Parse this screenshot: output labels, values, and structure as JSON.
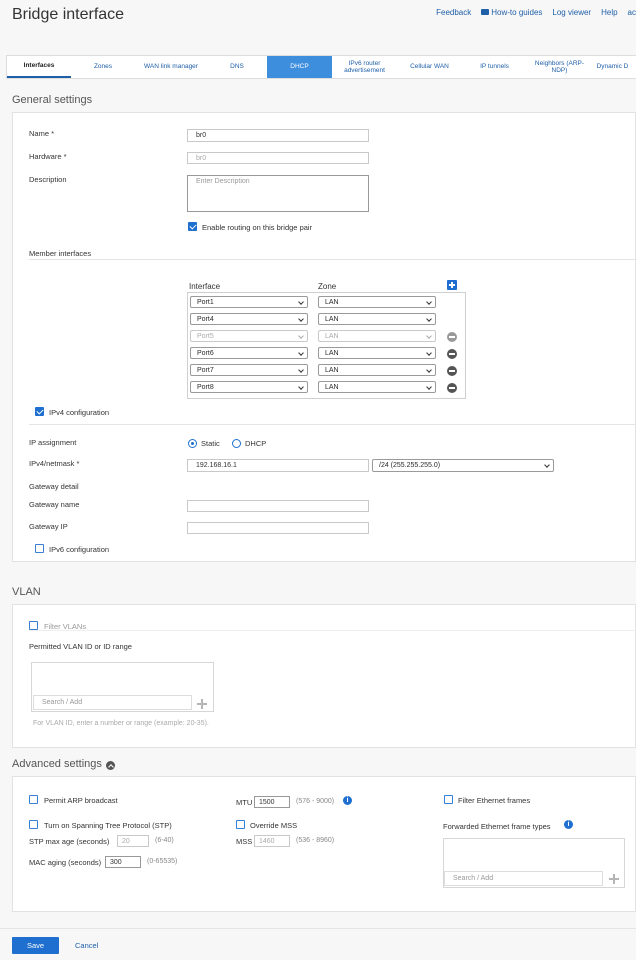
{
  "page": {
    "title": "Bridge interface"
  },
  "toplinks": {
    "feedback": "Feedback",
    "howto": "How-to guides",
    "logviewer": "Log viewer",
    "help": "Help",
    "user": "ac"
  },
  "tabs": [
    {
      "label": "Interfaces"
    },
    {
      "label": "Zones"
    },
    {
      "label": "WAN link manager"
    },
    {
      "label": "DNS"
    },
    {
      "label": "DHCP"
    },
    {
      "label": "IPv6 router advertisement"
    },
    {
      "label": "Cellular WAN"
    },
    {
      "label": "IP tunnels"
    },
    {
      "label": "Neighbors (ARP-NDP)"
    },
    {
      "label": "Dynamic D"
    }
  ],
  "general": {
    "title": "General settings",
    "name_label": "Name *",
    "name_value": "br0",
    "hardware_label": "Hardware *",
    "hardware_value": "br0",
    "description_label": "Description",
    "description_placeholder": "Enter Description",
    "routing_label": "Enable routing on this bridge pair",
    "member_label": "Member interfaces",
    "col_interface": "Interface",
    "col_zone": "Zone",
    "members": [
      {
        "port": "Port1",
        "zone": "LAN"
      },
      {
        "port": "Port4",
        "zone": "LAN"
      },
      {
        "port": "Port5",
        "zone": "LAN"
      },
      {
        "port": "Port6",
        "zone": "LAN"
      },
      {
        "port": "Port7",
        "zone": "LAN"
      },
      {
        "port": "Port8",
        "zone": "LAN"
      }
    ],
    "ipv4_label": "IPv4 configuration",
    "ip_assignment_label": "IP assignment",
    "static_label": "Static",
    "dhcp_label": "DHCP",
    "netmask_label": "IPv4/netmask *",
    "ip_value": "192.168.16.1",
    "netmask_value": "/24 (255.255.255.0)",
    "gateway_detail_label": "Gateway detail",
    "gateway_name_label": "Gateway name",
    "gateway_ip_label": "Gateway IP",
    "ipv6_label": "IPv6 configuration"
  },
  "vlan": {
    "title": "VLAN",
    "filter_label": "Filter VLANs",
    "permitted_label": "Permitted VLAN ID or ID range",
    "search_placeholder": "Search / Add",
    "hint": "For VLAN ID, enter a number or range (example: 20-35)."
  },
  "advanced": {
    "title": "Advanced settings",
    "arp_label": "Permit ARP broadcast",
    "stp_label": "Turn on Spanning Tree Protocol (STP)",
    "stp_age_label": "STP max age (seconds)",
    "stp_age_value": "20",
    "stp_age_hint": "(6-40)",
    "mac_label": "MAC aging (seconds)",
    "mac_value": "300",
    "mac_hint": "(0-65535)",
    "mtu_label": "MTU",
    "mtu_value": "1500",
    "mtu_hint": "(576 - 9000)",
    "override_mss_label": "Override MSS",
    "mss_label": "MSS",
    "mss_value": "1460",
    "mss_hint": "(536 - 8960)",
    "filter_frames_label": "Filter Ethernet frames",
    "frame_types_label": "Forwarded Ethernet frame types",
    "search_placeholder": "Search / Add"
  },
  "footer": {
    "save_label": "Save",
    "cancel_label": "Cancel"
  }
}
